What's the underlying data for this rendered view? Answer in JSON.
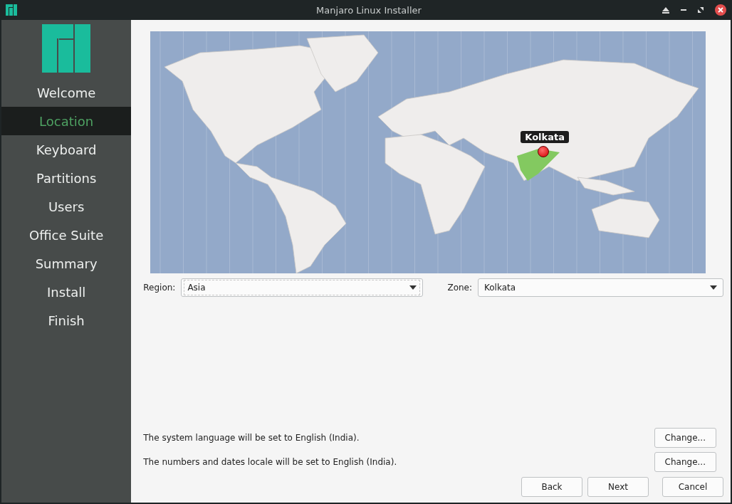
{
  "window": {
    "title": "Manjaro Linux Installer"
  },
  "sidebar": {
    "items": [
      {
        "label": "Welcome",
        "selected": false
      },
      {
        "label": "Location",
        "selected": true
      },
      {
        "label": "Keyboard",
        "selected": false
      },
      {
        "label": "Partitions",
        "selected": false
      },
      {
        "label": "Users",
        "selected": false
      },
      {
        "label": "Office Suite",
        "selected": false
      },
      {
        "label": "Summary",
        "selected": false
      },
      {
        "label": "Install",
        "selected": false
      },
      {
        "label": "Finish",
        "selected": false
      }
    ]
  },
  "map": {
    "pin_label": "Kolkata"
  },
  "region": {
    "label": "Region:",
    "value": "Asia",
    "focused": true
  },
  "zone": {
    "label": "Zone:",
    "value": "Kolkata",
    "focused": false
  },
  "locale_rows": [
    {
      "text": "The system language will be set to English (India).",
      "button": "Change..."
    },
    {
      "text": "The numbers and dates locale will be set to English (India).",
      "button": "Change..."
    }
  ],
  "buttons": [
    "Back",
    "Next",
    "Cancel"
  ]
}
